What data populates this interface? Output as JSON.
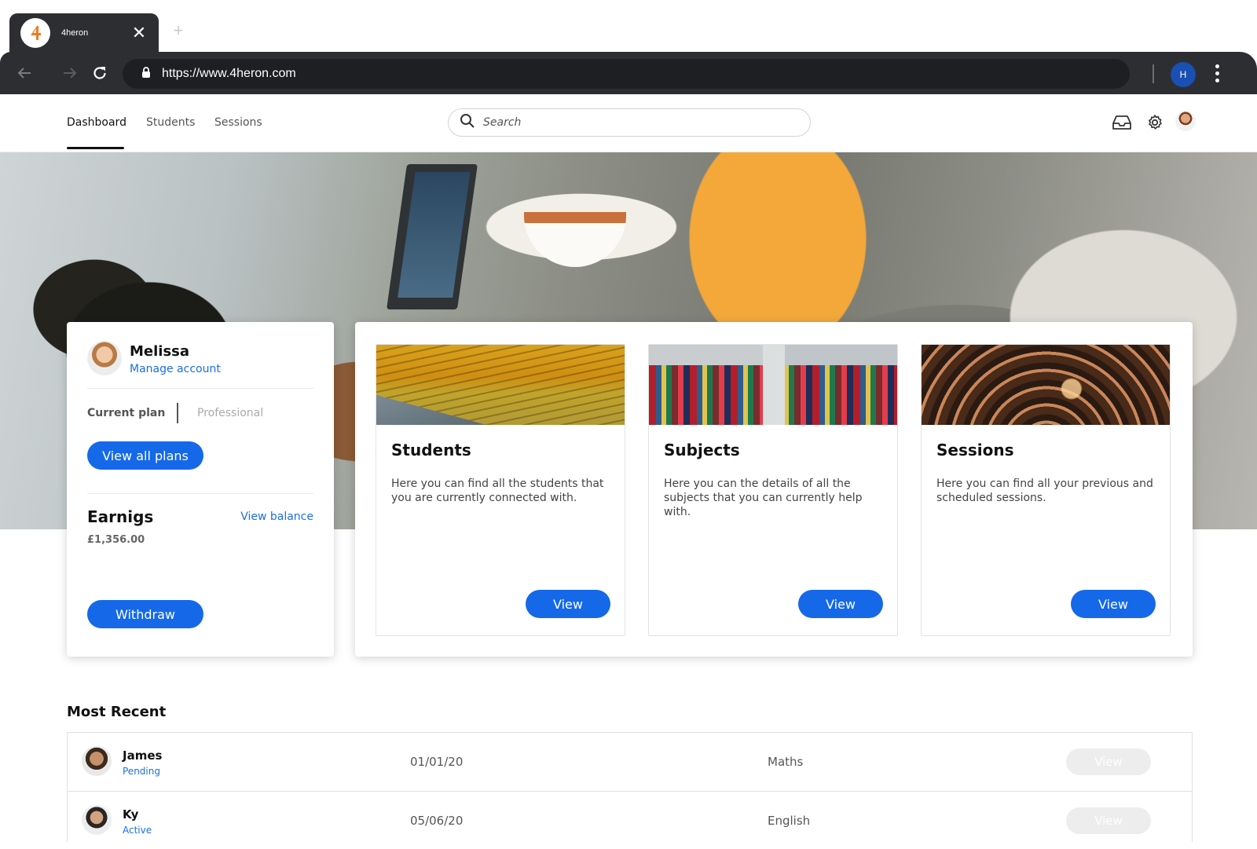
{
  "browser": {
    "tab_title": "4heron",
    "url": "https://www.4heron.com",
    "profile_initial": "H"
  },
  "nav": {
    "items": [
      {
        "label": "Dashboard",
        "active": true
      },
      {
        "label": "Students",
        "active": false
      },
      {
        "label": "Sessions",
        "active": false
      }
    ]
  },
  "search": {
    "placeholder": "Search"
  },
  "profile": {
    "name": "Melissa",
    "manage_label": "Manage account",
    "plan_label": "Current plan",
    "plan_value": "Professional",
    "view_plans_label": "View all plans",
    "earnings_title": "Earnigs",
    "view_balance_label": "View balance",
    "amount": "£1,356.00",
    "withdraw_label": "Withdraw"
  },
  "features": [
    {
      "title": "Students",
      "description": "Here you can find all the students that you are currently connected with.",
      "button": "View",
      "image": "theater-seats"
    },
    {
      "title": "Subjects",
      "description": "Here you can the details of all the subjects that you can currently help with.",
      "button": "View",
      "image": "bookshelf"
    },
    {
      "title": "Sessions",
      "description": "Here you can find all your previous and scheduled sessions.",
      "button": "View",
      "image": "concert-crowd"
    }
  ],
  "recent": {
    "title": "Most Recent",
    "rows": [
      {
        "name": "James",
        "status": "Pending",
        "date": "01/01/20",
        "subject": "Maths",
        "button": "View"
      },
      {
        "name": "Ky",
        "status": "Active",
        "date": "05/06/20",
        "subject": "English",
        "button": "View"
      }
    ]
  },
  "colors": {
    "accent": "#1569e8",
    "link": "#1a6fe8",
    "chrome_dark": "#2d2e31",
    "disabled_button": "#ededed"
  }
}
